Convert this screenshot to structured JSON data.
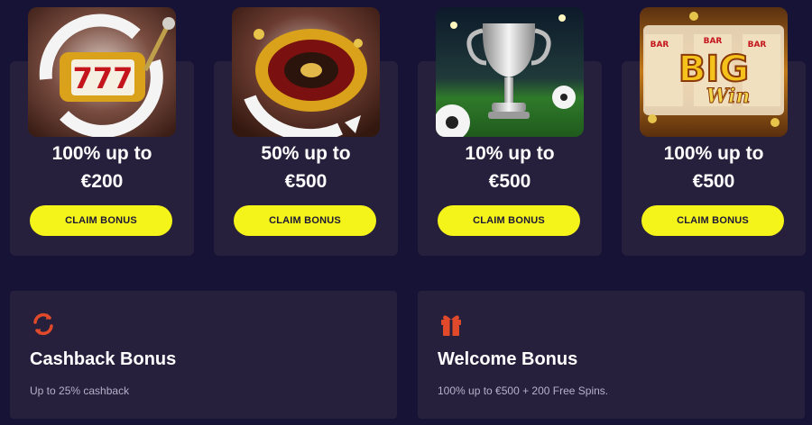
{
  "promotions": [
    {
      "image": "slot-machine-777",
      "offer_line1": "100% up to",
      "offer_line2": "€200",
      "button": "CLAIM BONUS"
    },
    {
      "image": "roulette-wheel",
      "offer_line1": "50% up to",
      "offer_line2": "€500",
      "button": "CLAIM BONUS"
    },
    {
      "image": "trophy-soccer",
      "offer_line1": "10% up to",
      "offer_line2": "€500",
      "button": "CLAIM BONUS"
    },
    {
      "image": "big-win-slot",
      "offer_line1": "100% up to",
      "offer_line2": "€500",
      "button": "CLAIM BONUS"
    }
  ],
  "bonuses": [
    {
      "icon": "cashback-refresh-icon",
      "title": "Cashback Bonus",
      "description": "Up to 25% cashback"
    },
    {
      "icon": "gift-icon",
      "title": "Welcome Bonus",
      "description": "100% up to €500 + 200 Free Spins."
    }
  ],
  "big_win_text": {
    "bar": "BAR",
    "big": "BIG",
    "win": "Win"
  },
  "colors": {
    "page_bg": "#171336",
    "card_bg": "#27203d",
    "button_bg": "#f4f31a",
    "button_text": "#1c1836",
    "icon_accent": "#e04a2a",
    "muted_text": "#b6b1c8"
  }
}
